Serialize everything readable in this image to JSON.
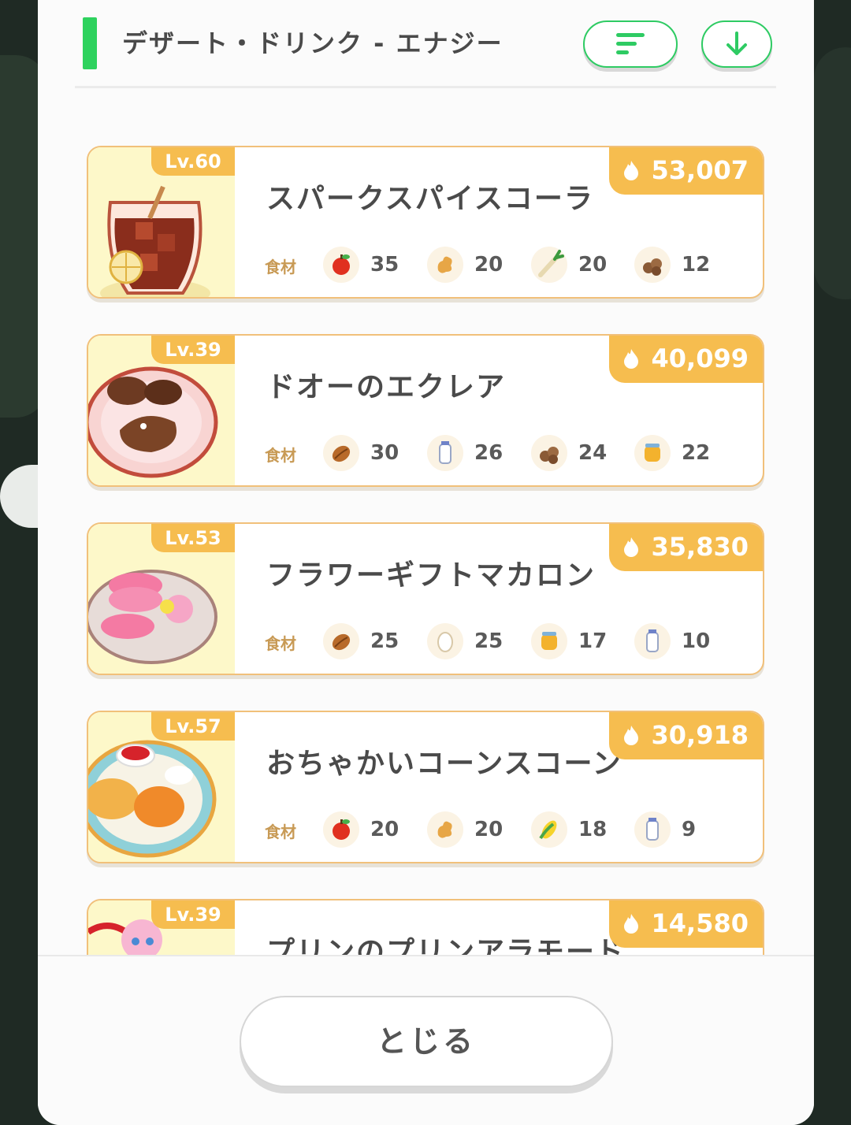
{
  "header": {
    "title": "デザート・ドリンク - エナジー",
    "sort_icon": "sort-lines-icon",
    "download_icon": "arrow-down-icon",
    "accent_color": "#2ed25e"
  },
  "ingredient_label": "食材",
  "recipes": [
    {
      "level": "Lv.60",
      "name": "スパークスパイスコーラ",
      "energy": "53,007",
      "ingredients": [
        {
          "icon": "apple-icon",
          "qty": "35"
        },
        {
          "icon": "ginger-icon",
          "qty": "20"
        },
        {
          "icon": "leek-icon",
          "qty": "20"
        },
        {
          "icon": "cacao-icon",
          "qty": "12"
        }
      ]
    },
    {
      "level": "Lv.39",
      "name": "ドオーのエクレア",
      "energy": "40,099",
      "ingredients": [
        {
          "icon": "coffee-bean-icon",
          "qty": "30"
        },
        {
          "icon": "milk-icon",
          "qty": "26"
        },
        {
          "icon": "cacao-icon",
          "qty": "24"
        },
        {
          "icon": "honey-icon",
          "qty": "22"
        }
      ]
    },
    {
      "level": "Lv.53",
      "name": "フラワーギフトマカロン",
      "energy": "35,830",
      "ingredients": [
        {
          "icon": "coffee-bean-icon",
          "qty": "25"
        },
        {
          "icon": "egg-icon",
          "qty": "25"
        },
        {
          "icon": "honey-icon",
          "qty": "17"
        },
        {
          "icon": "milk-icon",
          "qty": "10"
        }
      ]
    },
    {
      "level": "Lv.57",
      "name": "おちゃかいコーンスコーン",
      "energy": "30,918",
      "ingredients": [
        {
          "icon": "apple-icon",
          "qty": "20"
        },
        {
          "icon": "ginger-icon",
          "qty": "20"
        },
        {
          "icon": "corn-icon",
          "qty": "18"
        },
        {
          "icon": "milk-icon",
          "qty": "9"
        }
      ]
    },
    {
      "level": "Lv.39",
      "name": "プリンのプリンアラモード",
      "energy": "14,580",
      "ingredients": []
    }
  ],
  "footer": {
    "close_label": "とじる"
  }
}
